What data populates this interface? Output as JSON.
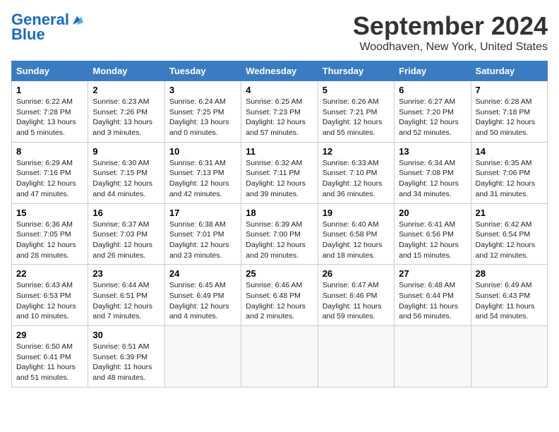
{
  "header": {
    "logo_line1": "General",
    "logo_line2": "Blue",
    "month": "September 2024",
    "location": "Woodhaven, New York, United States"
  },
  "days_of_week": [
    "Sunday",
    "Monday",
    "Tuesday",
    "Wednesday",
    "Thursday",
    "Friday",
    "Saturday"
  ],
  "weeks": [
    [
      {
        "day": "1",
        "text": "Sunrise: 6:22 AM\nSunset: 7:28 PM\nDaylight: 13 hours\nand 5 minutes."
      },
      {
        "day": "2",
        "text": "Sunrise: 6:23 AM\nSunset: 7:26 PM\nDaylight: 13 hours\nand 3 minutes."
      },
      {
        "day": "3",
        "text": "Sunrise: 6:24 AM\nSunset: 7:25 PM\nDaylight: 13 hours\nand 0 minutes."
      },
      {
        "day": "4",
        "text": "Sunrise: 6:25 AM\nSunset: 7:23 PM\nDaylight: 12 hours\nand 57 minutes."
      },
      {
        "day": "5",
        "text": "Sunrise: 6:26 AM\nSunset: 7:21 PM\nDaylight: 12 hours\nand 55 minutes."
      },
      {
        "day": "6",
        "text": "Sunrise: 6:27 AM\nSunset: 7:20 PM\nDaylight: 12 hours\nand 52 minutes."
      },
      {
        "day": "7",
        "text": "Sunrise: 6:28 AM\nSunset: 7:18 PM\nDaylight: 12 hours\nand 50 minutes."
      }
    ],
    [
      {
        "day": "8",
        "text": "Sunrise: 6:29 AM\nSunset: 7:16 PM\nDaylight: 12 hours\nand 47 minutes."
      },
      {
        "day": "9",
        "text": "Sunrise: 6:30 AM\nSunset: 7:15 PM\nDaylight: 12 hours\nand 44 minutes."
      },
      {
        "day": "10",
        "text": "Sunrise: 6:31 AM\nSunset: 7:13 PM\nDaylight: 12 hours\nand 42 minutes."
      },
      {
        "day": "11",
        "text": "Sunrise: 6:32 AM\nSunset: 7:11 PM\nDaylight: 12 hours\nand 39 minutes."
      },
      {
        "day": "12",
        "text": "Sunrise: 6:33 AM\nSunset: 7:10 PM\nDaylight: 12 hours\nand 36 minutes."
      },
      {
        "day": "13",
        "text": "Sunrise: 6:34 AM\nSunset: 7:08 PM\nDaylight: 12 hours\nand 34 minutes."
      },
      {
        "day": "14",
        "text": "Sunrise: 6:35 AM\nSunset: 7:06 PM\nDaylight: 12 hours\nand 31 minutes."
      }
    ],
    [
      {
        "day": "15",
        "text": "Sunrise: 6:36 AM\nSunset: 7:05 PM\nDaylight: 12 hours\nand 28 minutes."
      },
      {
        "day": "16",
        "text": "Sunrise: 6:37 AM\nSunset: 7:03 PM\nDaylight: 12 hours\nand 26 minutes."
      },
      {
        "day": "17",
        "text": "Sunrise: 6:38 AM\nSunset: 7:01 PM\nDaylight: 12 hours\nand 23 minutes."
      },
      {
        "day": "18",
        "text": "Sunrise: 6:39 AM\nSunset: 7:00 PM\nDaylight: 12 hours\nand 20 minutes."
      },
      {
        "day": "19",
        "text": "Sunrise: 6:40 AM\nSunset: 6:58 PM\nDaylight: 12 hours\nand 18 minutes."
      },
      {
        "day": "20",
        "text": "Sunrise: 6:41 AM\nSunset: 6:56 PM\nDaylight: 12 hours\nand 15 minutes."
      },
      {
        "day": "21",
        "text": "Sunrise: 6:42 AM\nSunset: 6:54 PM\nDaylight: 12 hours\nand 12 minutes."
      }
    ],
    [
      {
        "day": "22",
        "text": "Sunrise: 6:43 AM\nSunset: 6:53 PM\nDaylight: 12 hours\nand 10 minutes."
      },
      {
        "day": "23",
        "text": "Sunrise: 6:44 AM\nSunset: 6:51 PM\nDaylight: 12 hours\nand 7 minutes."
      },
      {
        "day": "24",
        "text": "Sunrise: 6:45 AM\nSunset: 6:49 PM\nDaylight: 12 hours\nand 4 minutes."
      },
      {
        "day": "25",
        "text": "Sunrise: 6:46 AM\nSunset: 6:48 PM\nDaylight: 12 hours\nand 2 minutes."
      },
      {
        "day": "26",
        "text": "Sunrise: 6:47 AM\nSunset: 6:46 PM\nDaylight: 11 hours\nand 59 minutes."
      },
      {
        "day": "27",
        "text": "Sunrise: 6:48 AM\nSunset: 6:44 PM\nDaylight: 11 hours\nand 56 minutes."
      },
      {
        "day": "28",
        "text": "Sunrise: 6:49 AM\nSunset: 6:43 PM\nDaylight: 11 hours\nand 54 minutes."
      }
    ],
    [
      {
        "day": "29",
        "text": "Sunrise: 6:50 AM\nSunset: 6:41 PM\nDaylight: 11 hours\nand 51 minutes."
      },
      {
        "day": "30",
        "text": "Sunrise: 6:51 AM\nSunset: 6:39 PM\nDaylight: 11 hours\nand 48 minutes."
      },
      {
        "day": "",
        "text": ""
      },
      {
        "day": "",
        "text": ""
      },
      {
        "day": "",
        "text": ""
      },
      {
        "day": "",
        "text": ""
      },
      {
        "day": "",
        "text": ""
      }
    ]
  ]
}
